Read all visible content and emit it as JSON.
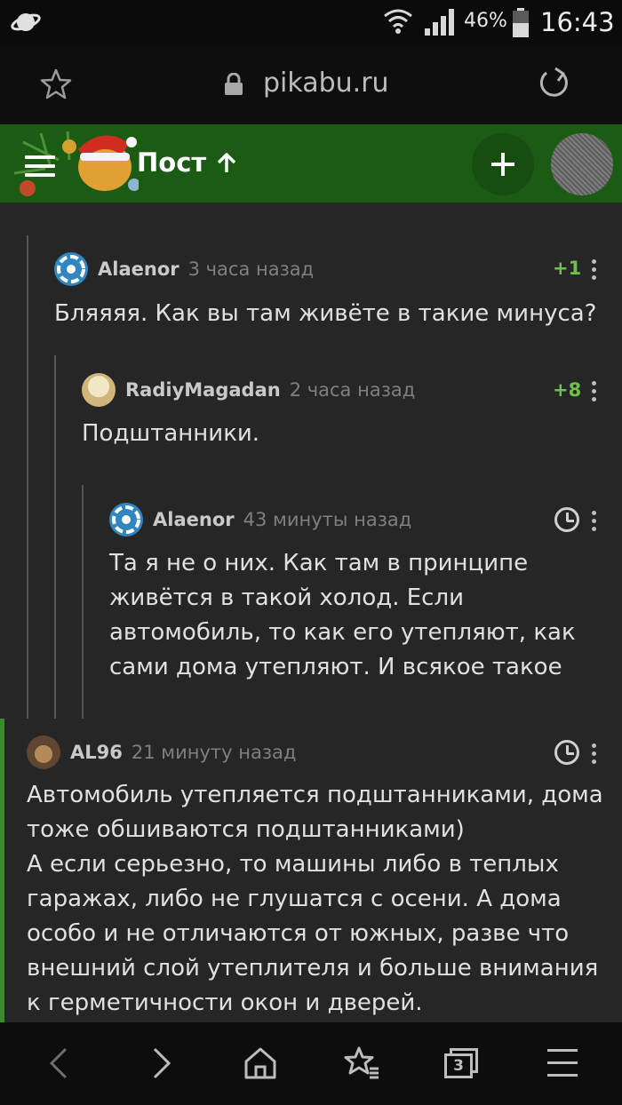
{
  "status_bar": {
    "battery": "46%",
    "time": "16:43"
  },
  "browser": {
    "url": "pikabu.ru"
  },
  "header": {
    "title": "Пост"
  },
  "comments": [
    {
      "author": "Alaenor",
      "time": "3 часа назад",
      "rating": "+1",
      "text": "Бляяяя. Как вы там живёте в такие минуса?"
    },
    {
      "author": "RadiyMagadan",
      "time": "2 часа назад",
      "rating": "+8",
      "text": "Подштанники."
    },
    {
      "author": "Alaenor",
      "time": "43 минуты назад",
      "text": "Та я не о них. Как там в принципе\nживётся в такой холод. Если\nавтомобиль, то как его утепляют, как\nсами дома утепляют. И всякое такое"
    },
    {
      "author": "AL96",
      "time": "21 минуту назад",
      "text": "Автомобиль утепляется подштанниками, дома\nтоже обшиваются подштанниками)\nА если серьезно, то машины либо в теплых\nгаражах, либо не глушатся с осени. А дома\nособо и не отличаются от южных, разве что\nвнешний слой утеплителя и больше внимания\nк герметичности окон и дверей."
    }
  ],
  "bottom_nav": {
    "tabs_count": "3"
  },
  "icons": [
    "planet-icon",
    "wifi-icon",
    "signal-icon",
    "battery-icon",
    "star-icon",
    "lock-icon",
    "reload-icon",
    "menu-icon",
    "mascot-icon",
    "arrow-up-icon",
    "plus-icon",
    "clock-icon",
    "more-icon",
    "back-icon",
    "forward-icon",
    "home-icon",
    "bookmarks-icon",
    "tabs-icon"
  ],
  "colors": {
    "header_bg": "#1c5b14",
    "rating": "#6fbf4f",
    "accent_bar": "#3d8a2c"
  }
}
